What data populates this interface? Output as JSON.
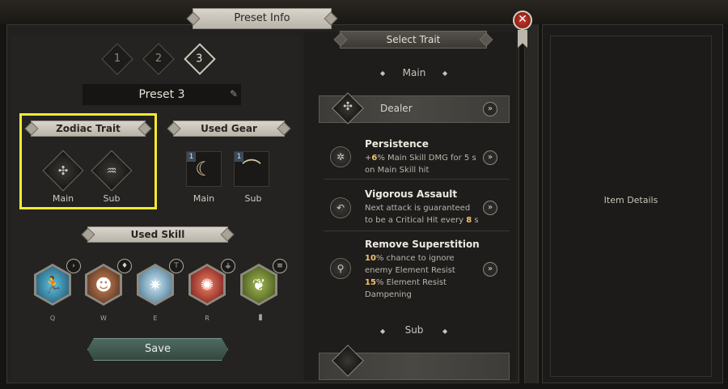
{
  "window": {
    "title": "Preset Info",
    "close_icon": "close-icon"
  },
  "presets": {
    "tabs": [
      "1",
      "2",
      "3"
    ],
    "active": "3",
    "name": "Preset 3"
  },
  "zodiac": {
    "title": "Zodiac Trait",
    "main_label": "Main",
    "sub_label": "Sub"
  },
  "gear": {
    "title": "Used Gear",
    "items": [
      {
        "level": "1",
        "label": "Main"
      },
      {
        "level": "1",
        "label": "Sub"
      }
    ]
  },
  "skills": {
    "title": "Used Skill",
    "keys": [
      "Q",
      "W",
      "E",
      "R"
    ],
    "save_label": "Save"
  },
  "select_trait": {
    "title": "Select Trait",
    "main_header": "Main",
    "dealer_label": "Dealer",
    "sub_header": "Sub",
    "entries": [
      {
        "title": "Persistence",
        "desc_pre": "+",
        "hl1": "6",
        "desc_mid": "% Main Skill DMG for 5 s",
        "desc_line2": "on Main Skill hit"
      },
      {
        "title": "Vigorous Assault",
        "line1": "Next attack is guaranteed",
        "line2_pre": "to be a Critical Hit every ",
        "hl1": "8",
        "line2_post": " s"
      },
      {
        "title": "Remove Superstition",
        "hl1": "10",
        "line1_post": "% chance to ignore",
        "line2": "enemy Element Resist",
        "hl2": "15",
        "line3_post": "% Element Resist",
        "line4": "Dampening"
      }
    ]
  },
  "item_details": {
    "title": "Item Details"
  },
  "colors": {
    "highlight": "#f7e930",
    "save_button": "#44605a",
    "accent_number": "#f4c36a"
  }
}
